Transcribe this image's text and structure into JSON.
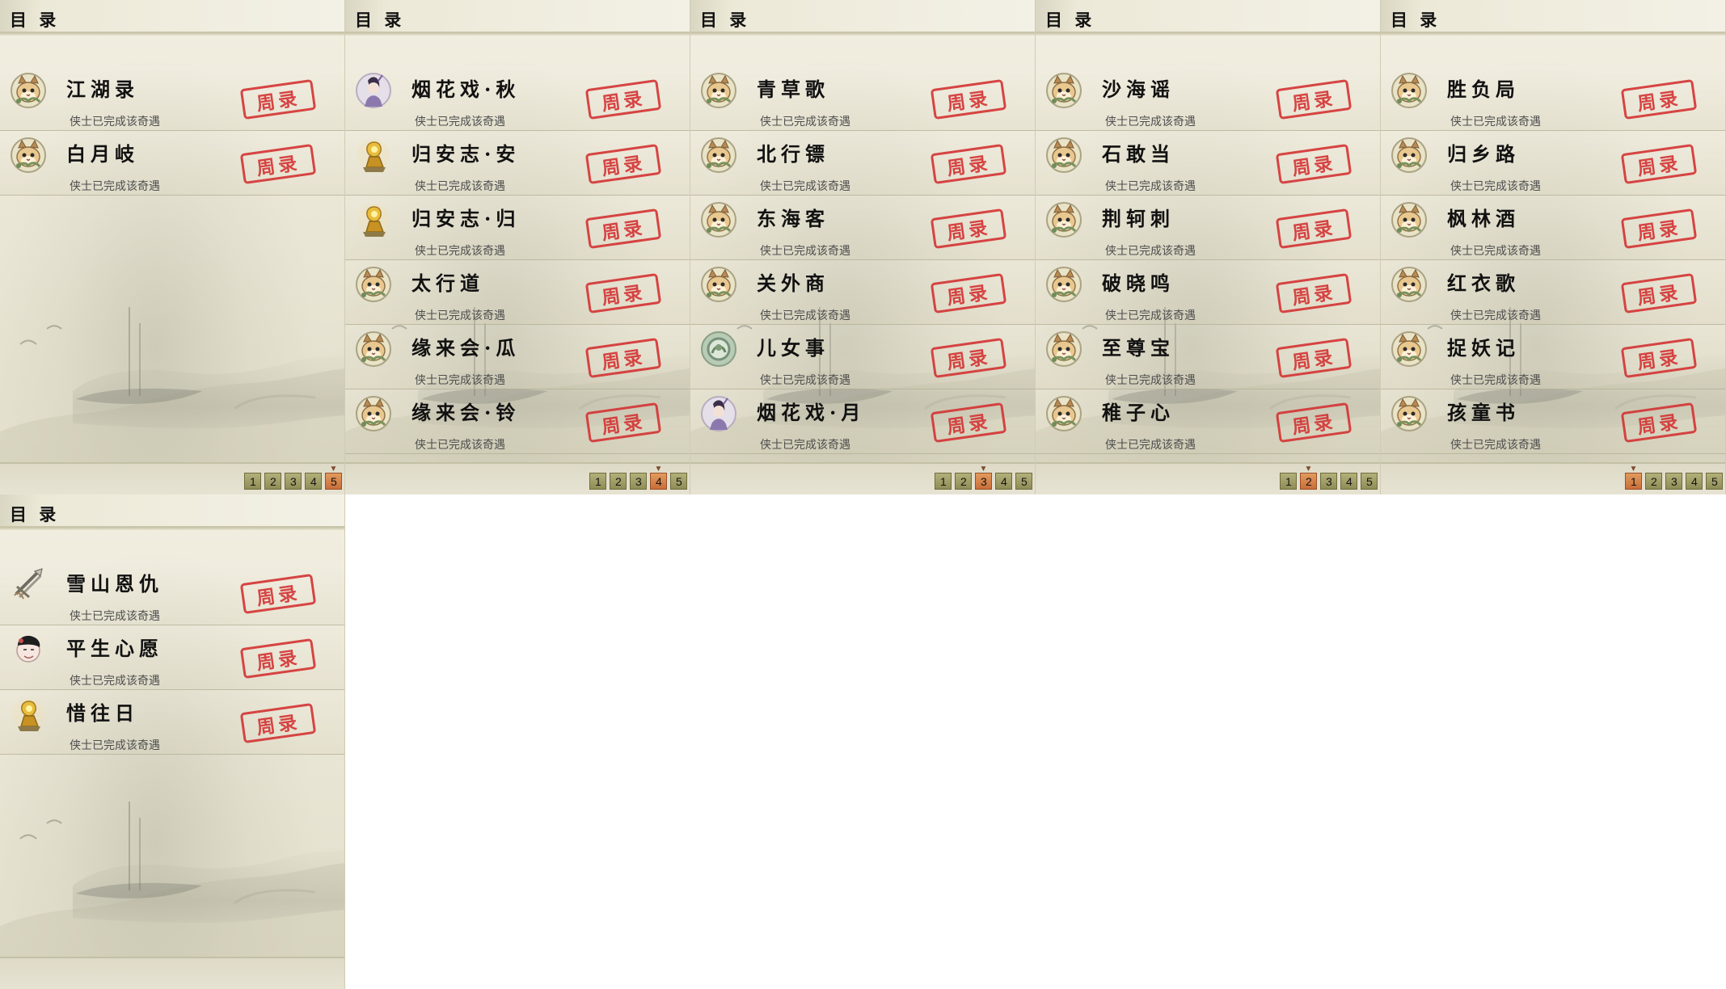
{
  "theme": {
    "stamp_color": "#d43333",
    "active_page_color": "#d98749",
    "page_button_color": "#9c9a63"
  },
  "panels": [
    {
      "title": "目 录",
      "active_page": "5",
      "pages": [
        "1",
        "2",
        "3",
        "4",
        "5"
      ],
      "entries": [
        {
          "name": "江湖录",
          "status": "侠士已完成该奇遇",
          "icon": "cat-icon",
          "stamp": "周录"
        },
        {
          "name": "白月岐",
          "status": "侠士已完成该奇遇",
          "icon": "cat-icon",
          "stamp": "周录"
        }
      ]
    },
    {
      "title": "目 录",
      "active_page": "4",
      "pages": [
        "1",
        "2",
        "3",
        "4",
        "5"
      ],
      "entries": [
        {
          "name": "烟花戏·秋",
          "status": "侠士已完成该奇遇",
          "icon": "lady-icon",
          "stamp": "周录"
        },
        {
          "name": "归安志·安",
          "status": "侠士已完成该奇遇",
          "icon": "golden-figure-icon",
          "stamp": "周录"
        },
        {
          "name": "归安志·归",
          "status": "侠士已完成该奇遇",
          "icon": "golden-figure-icon",
          "stamp": "周录"
        },
        {
          "name": "太行道",
          "status": "侠士已完成该奇遇",
          "icon": "cat-icon",
          "stamp": "周录"
        },
        {
          "name": "缘来会·瓜",
          "status": "侠士已完成该奇遇",
          "icon": "cat-icon",
          "stamp": "周录"
        },
        {
          "name": "缘来会·铃",
          "status": "侠士已完成该奇遇",
          "icon": "cat-icon",
          "stamp": "周录"
        }
      ]
    },
    {
      "title": "目 录",
      "active_page": "3",
      "pages": [
        "1",
        "2",
        "3",
        "4",
        "5"
      ],
      "entries": [
        {
          "name": "青草歌",
          "status": "侠士已完成该奇遇",
          "icon": "cat-icon",
          "stamp": "周录"
        },
        {
          "name": "北行镖",
          "status": "侠士已完成该奇遇",
          "icon": "cat-icon",
          "stamp": "周录"
        },
        {
          "name": "东海客",
          "status": "侠士已完成该奇遇",
          "icon": "cat-icon",
          "stamp": "周录"
        },
        {
          "name": "关外商",
          "status": "侠士已完成该奇遇",
          "icon": "cat-icon",
          "stamp": "周录"
        },
        {
          "name": "儿女事",
          "status": "侠士已完成该奇遇",
          "icon": "jade-icon",
          "stamp": "周录"
        },
        {
          "name": "烟花戏·月",
          "status": "侠士已完成该奇遇",
          "icon": "lady-icon",
          "stamp": "周录"
        }
      ]
    },
    {
      "title": "目 录",
      "active_page": "2",
      "pages": [
        "1",
        "2",
        "3",
        "4",
        "5"
      ],
      "entries": [
        {
          "name": "沙海谣",
          "status": "侠士已完成该奇遇",
          "icon": "cat-icon",
          "stamp": "周录"
        },
        {
          "name": "石敢当",
          "status": "侠士已完成该奇遇",
          "icon": "cat-icon",
          "stamp": "周录"
        },
        {
          "name": "荆轲刺",
          "status": "侠士已完成该奇遇",
          "icon": "cat-icon",
          "stamp": "周录"
        },
        {
          "name": "破晓鸣",
          "status": "侠士已完成该奇遇",
          "icon": "cat-icon",
          "stamp": "周录"
        },
        {
          "name": "至尊宝",
          "status": "侠士已完成该奇遇",
          "icon": "cat-icon",
          "stamp": "周录"
        },
        {
          "name": "稚子心",
          "status": "侠士已完成该奇遇",
          "icon": "cat-icon",
          "stamp": "周录"
        }
      ]
    },
    {
      "title": "目 录",
      "active_page": "1",
      "pages": [
        "1",
        "2",
        "3",
        "4",
        "5"
      ],
      "entries": [
        {
          "name": "胜负局",
          "status": "侠士已完成该奇遇",
          "icon": "cat-icon",
          "stamp": "周录"
        },
        {
          "name": "归乡路",
          "status": "侠士已完成该奇遇",
          "icon": "cat-icon",
          "stamp": "周录"
        },
        {
          "name": "枫林酒",
          "status": "侠士已完成该奇遇",
          "icon": "cat-icon",
          "stamp": "周录"
        },
        {
          "name": "红衣歌",
          "status": "侠士已完成该奇遇",
          "icon": "cat-icon",
          "stamp": "周录"
        },
        {
          "name": "捉妖记",
          "status": "侠士已完成该奇遇",
          "icon": "cat-icon",
          "stamp": "周录"
        },
        {
          "name": "孩童书",
          "status": "侠士已完成该奇遇",
          "icon": "cat-icon",
          "stamp": "周录"
        }
      ]
    },
    {
      "title": "目 录",
      "active_page": "",
      "pages": [],
      "entries": [
        {
          "name": "雪山恩仇",
          "status": "侠士已完成该奇遇",
          "icon": "weapon-icon",
          "stamp": "周录"
        },
        {
          "name": "平生心愿",
          "status": "侠士已完成该奇遇",
          "icon": "child-icon",
          "stamp": "周录"
        },
        {
          "name": "惜往日",
          "status": "侠士已完成该奇遇",
          "icon": "golden-figure-icon",
          "stamp": "周录"
        }
      ]
    }
  ]
}
